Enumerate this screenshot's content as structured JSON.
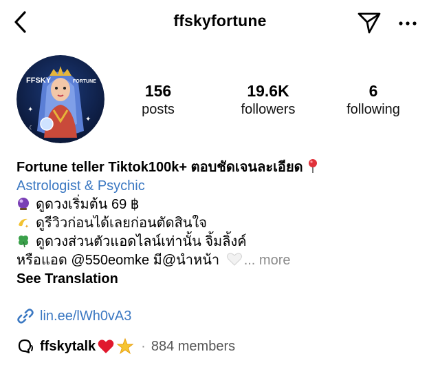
{
  "header": {
    "username": "ffskyfortune",
    "back_icon": "chevron-left-icon",
    "send_icon": "paper-plane-icon",
    "more_icon": "more-horizontal-icon"
  },
  "avatar": {
    "text_left": "FFSKY",
    "text_right": "FORTUNE"
  },
  "stats": {
    "posts": {
      "value": "156",
      "label": "posts"
    },
    "followers": {
      "value": "19.6K",
      "label": "followers"
    },
    "following": {
      "value": "6",
      "label": "following"
    }
  },
  "bio": {
    "name": "Fortune teller Tiktok100k+ ตอบชัดเจนละเอียด",
    "category": "Astrologist & Psychic",
    "line1": "ดูดวงเริ่มต้น 69 ฿",
    "line2": "ดูรีวิวก่อนได้เลยก่อนตัดสินใจ",
    "line3": "ดูดวงส่วนตัวแอดไลน์เท่านั้น จิ้มลิ้งค์",
    "line4": "หรือแอด @550eomke มี@นำหน้า",
    "more_label": "... more",
    "see_translation": "See Translation"
  },
  "link": {
    "url_text": "lin.ee/lWh0vA3"
  },
  "channel": {
    "name": "ffskytalk",
    "members": "884 members"
  },
  "colors": {
    "link_blue": "#3b78c2",
    "muted_gray": "#8a8a8a",
    "avatar_bg": "#0f1f4a"
  }
}
